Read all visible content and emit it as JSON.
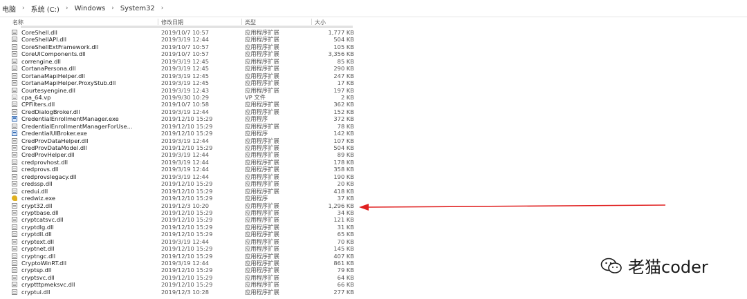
{
  "breadcrumb": [
    "电脑",
    "系统 (C:)",
    "Windows",
    "System32"
  ],
  "columns": {
    "name": "名称",
    "date": "修改日期",
    "type": "类型",
    "size": "大小"
  },
  "files": [
    {
      "name": "CoreShell.dll",
      "date": "2019/10/7 10:57",
      "type": "应用程序扩展",
      "size": "1,777 KB",
      "icon": "dll-icon"
    },
    {
      "name": "CoreShellAPI.dll",
      "date": "2019/3/19 12:44",
      "type": "应用程序扩展",
      "size": "504 KB",
      "icon": "dll-icon"
    },
    {
      "name": "CoreShellExtFramework.dll",
      "date": "2019/10/7 10:57",
      "type": "应用程序扩展",
      "size": "105 KB",
      "icon": "dll-icon"
    },
    {
      "name": "CoreUIComponents.dll",
      "date": "2019/10/7 10:57",
      "type": "应用程序扩展",
      "size": "3,356 KB",
      "icon": "dll-icon"
    },
    {
      "name": "correngine.dll",
      "date": "2019/3/19 12:45",
      "type": "应用程序扩展",
      "size": "85 KB",
      "icon": "dll-icon"
    },
    {
      "name": "CortanaPersona.dll",
      "date": "2019/3/19 12:45",
      "type": "应用程序扩展",
      "size": "290 KB",
      "icon": "dll-icon"
    },
    {
      "name": "CortanaMapiHelper.dll",
      "date": "2019/3/19 12:45",
      "type": "应用程序扩展",
      "size": "247 KB",
      "icon": "dll-icon"
    },
    {
      "name": "CortanaMapiHelper.ProxyStub.dll",
      "date": "2019/3/19 12:45",
      "type": "应用程序扩展",
      "size": "17 KB",
      "icon": "dll-icon"
    },
    {
      "name": "Courtesyengine.dll",
      "date": "2019/3/19 12:43",
      "type": "应用程序扩展",
      "size": "197 KB",
      "icon": "dll-icon"
    },
    {
      "name": "cpa_64.vp",
      "date": "2019/9/30 10:29",
      "type": "VP 文件",
      "size": "2 KB",
      "icon": "vp-file-icon"
    },
    {
      "name": "CPFilters.dll",
      "date": "2019/10/7 10:58",
      "type": "应用程序扩展",
      "size": "362 KB",
      "icon": "dll-icon"
    },
    {
      "name": "CredDialogBroker.dll",
      "date": "2019/3/19 12:44",
      "type": "应用程序扩展",
      "size": "152 KB",
      "icon": "dll-icon"
    },
    {
      "name": "CredentialEnrollmentManager.exe",
      "date": "2019/12/10 15:29",
      "type": "应用程序",
      "size": "372 KB",
      "icon": "exe-icon"
    },
    {
      "name": "CredentialEnrollmentManagerForUse...",
      "date": "2019/12/10 15:29",
      "type": "应用程序扩展",
      "size": "78 KB",
      "icon": "dll-icon"
    },
    {
      "name": "CredentialUIBroker.exe",
      "date": "2019/12/10 15:29",
      "type": "应用程序",
      "size": "142 KB",
      "icon": "exe-icon"
    },
    {
      "name": "CredProvDataHelper.dll",
      "date": "2019/3/19 12:44",
      "type": "应用程序扩展",
      "size": "107 KB",
      "icon": "dll-icon"
    },
    {
      "name": "CredProvDataModel.dll",
      "date": "2019/12/10 15:29",
      "type": "应用程序扩展",
      "size": "504 KB",
      "icon": "dll-icon"
    },
    {
      "name": "CredProvHelper.dll",
      "date": "2019/3/19 12:44",
      "type": "应用程序扩展",
      "size": "89 KB",
      "icon": "dll-icon"
    },
    {
      "name": "credprovhost.dll",
      "date": "2019/3/19 12:44",
      "type": "应用程序扩展",
      "size": "178 KB",
      "icon": "dll-icon"
    },
    {
      "name": "credprovs.dll",
      "date": "2019/3/19 12:44",
      "type": "应用程序扩展",
      "size": "358 KB",
      "icon": "dll-icon"
    },
    {
      "name": "credprovslegacy.dll",
      "date": "2019/3/19 12:44",
      "type": "应用程序扩展",
      "size": "190 KB",
      "icon": "dll-icon"
    },
    {
      "name": "credssp.dll",
      "date": "2019/12/10 15:29",
      "type": "应用程序扩展",
      "size": "20 KB",
      "icon": "dll-icon"
    },
    {
      "name": "credui.dll",
      "date": "2019/12/10 15:29",
      "type": "应用程序扩展",
      "size": "418 KB",
      "icon": "dll-icon"
    },
    {
      "name": "credwiz.exe",
      "date": "2019/12/10 15:29",
      "type": "应用程序",
      "size": "37 KB",
      "icon": "wizard-exe-icon"
    },
    {
      "name": "crypt32.dll",
      "date": "2019/12/3 10:20",
      "type": "应用程序扩展",
      "size": "1,296 KB",
      "icon": "dll-icon"
    },
    {
      "name": "cryptbase.dll",
      "date": "2019/12/10 15:29",
      "type": "应用程序扩展",
      "size": "34 KB",
      "icon": "dll-icon"
    },
    {
      "name": "cryptcatsvc.dll",
      "date": "2019/12/10 15:29",
      "type": "应用程序扩展",
      "size": "121 KB",
      "icon": "dll-icon"
    },
    {
      "name": "cryptdlg.dll",
      "date": "2019/12/10 15:29",
      "type": "应用程序扩展",
      "size": "31 KB",
      "icon": "dll-icon"
    },
    {
      "name": "cryptdll.dll",
      "date": "2019/12/10 15:29",
      "type": "应用程序扩展",
      "size": "65 KB",
      "icon": "dll-icon"
    },
    {
      "name": "cryptext.dll",
      "date": "2019/3/19 12:44",
      "type": "应用程序扩展",
      "size": "70 KB",
      "icon": "dll-icon"
    },
    {
      "name": "cryptnet.dll",
      "date": "2019/12/10 15:29",
      "type": "应用程序扩展",
      "size": "145 KB",
      "icon": "dll-icon"
    },
    {
      "name": "cryptngc.dll",
      "date": "2019/12/10 15:29",
      "type": "应用程序扩展",
      "size": "407 KB",
      "icon": "dll-icon"
    },
    {
      "name": "CryptoWinRT.dll",
      "date": "2019/3/19 12:44",
      "type": "应用程序扩展",
      "size": "861 KB",
      "icon": "dll-icon"
    },
    {
      "name": "cryptsp.dll",
      "date": "2019/12/10 15:29",
      "type": "应用程序扩展",
      "size": "79 KB",
      "icon": "dll-icon"
    },
    {
      "name": "cryptsvc.dll",
      "date": "2019/12/10 15:29",
      "type": "应用程序扩展",
      "size": "64 KB",
      "icon": "dll-icon"
    },
    {
      "name": "cryptttpmeksvc.dll",
      "date": "2019/12/10 15:29",
      "type": "应用程序扩展",
      "size": "66 KB",
      "icon": "dll-icon"
    },
    {
      "name": "cryptui.dll",
      "date": "2019/12/3 10:28",
      "type": "应用程序扩展",
      "size": "277 KB",
      "icon": "dll-icon"
    }
  ],
  "annotation": {
    "arrow_color": "#e02020",
    "target_file": "crypt32.dll"
  },
  "watermark": {
    "text": "老猫coder",
    "icon": "wechat-icon"
  }
}
